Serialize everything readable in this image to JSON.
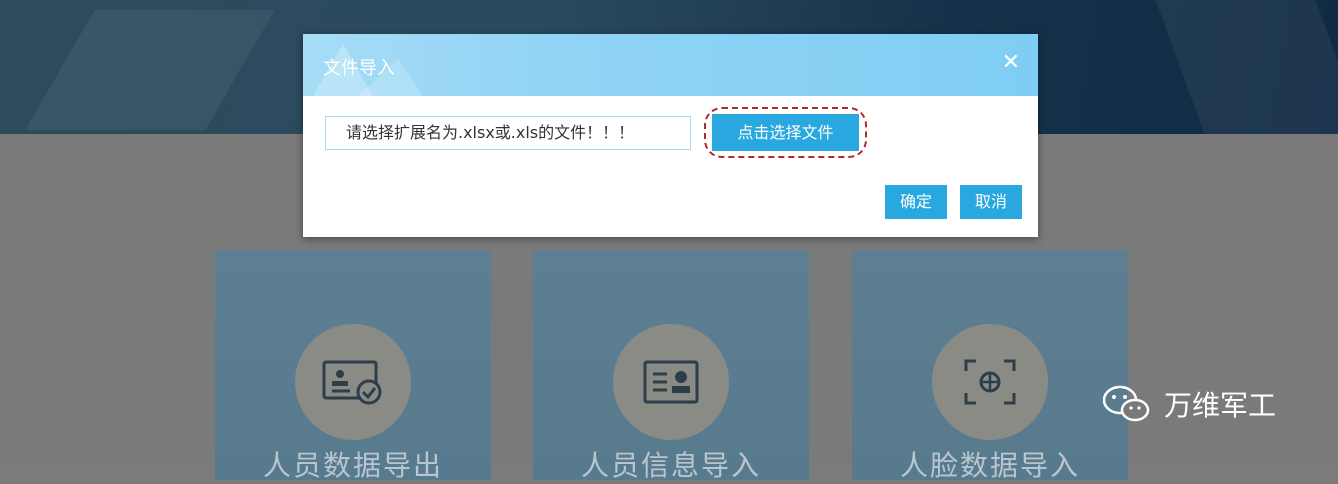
{
  "dialog": {
    "title": "文件导入",
    "file_placeholder": "请选择扩展名为.xlsx或.xls的文件！！！",
    "choose_file_label": "点击选择文件",
    "confirm_label": "确定",
    "cancel_label": "取消"
  },
  "cards": [
    {
      "label": "人员数据导出",
      "icon": "id-card-check-icon"
    },
    {
      "label": "人员信息导入",
      "icon": "id-card-icon"
    },
    {
      "label": "人脸数据导入",
      "icon": "face-scan-icon"
    }
  ],
  "watermark": {
    "text": "万维军工",
    "icon": "wechat-icon"
  },
  "colors": {
    "accent": "#28a8de",
    "header": "#8fd3f5",
    "overlay": "#7a7a7a",
    "highlight_ring": "#b12a2a"
  }
}
